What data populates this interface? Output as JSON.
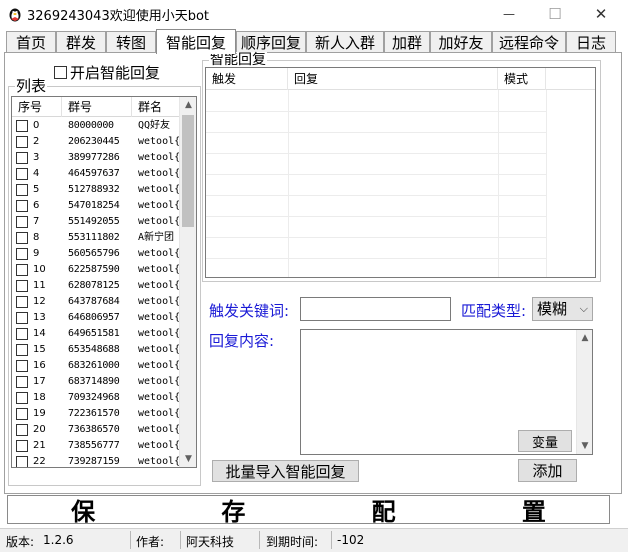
{
  "window": {
    "title": "3269243043欢迎使用小天bot",
    "min_glyph": "—",
    "max_glyph": "☐",
    "close_glyph": "✕"
  },
  "tabs": [
    {
      "label": "首页",
      "active": false
    },
    {
      "label": "群发",
      "active": false
    },
    {
      "label": "转图",
      "active": false
    },
    {
      "label": "智能回复",
      "active": true
    },
    {
      "label": "顺序回复",
      "active": false
    },
    {
      "label": "新人入群",
      "active": false
    },
    {
      "label": "加群",
      "active": false
    },
    {
      "label": "加好友",
      "active": false
    },
    {
      "label": "远程命令",
      "active": false
    },
    {
      "label": "日志",
      "active": false
    }
  ],
  "enable_checkbox": {
    "label": "开启智能回复",
    "checked": false
  },
  "list_panel": {
    "legend": "列表",
    "columns": [
      "序号",
      "群号",
      "群名"
    ],
    "rows": [
      {
        "no": "0",
        "id": "80000000",
        "name": "QQ好友"
      },
      {
        "no": "2",
        "id": "206230445",
        "name": "wetool{"
      },
      {
        "no": "3",
        "id": "389977286",
        "name": "wetool{"
      },
      {
        "no": "4",
        "id": "464597637",
        "name": "wetool{"
      },
      {
        "no": "5",
        "id": "512788932",
        "name": "wetool{"
      },
      {
        "no": "6",
        "id": "547018254",
        "name": "wetool{"
      },
      {
        "no": "7",
        "id": "551492055",
        "name": "wetool{"
      },
      {
        "no": "8",
        "id": "553111802",
        "name": "A新宁团"
      },
      {
        "no": "9",
        "id": "560565796",
        "name": "wetool{"
      },
      {
        "no": "10",
        "id": "622587590",
        "name": "wetool{"
      },
      {
        "no": "11",
        "id": "628078125",
        "name": "wetool{"
      },
      {
        "no": "12",
        "id": "643787684",
        "name": "wetool{"
      },
      {
        "no": "13",
        "id": "646806957",
        "name": "wetool{"
      },
      {
        "no": "14",
        "id": "649651581",
        "name": "wetool{"
      },
      {
        "no": "15",
        "id": "653548688",
        "name": "wetool{"
      },
      {
        "no": "16",
        "id": "683261000",
        "name": "wetool{"
      },
      {
        "no": "17",
        "id": "683714890",
        "name": "wetool{"
      },
      {
        "no": "18",
        "id": "709324968",
        "name": "wetool{"
      },
      {
        "no": "19",
        "id": "722361570",
        "name": "wetool{"
      },
      {
        "no": "20",
        "id": "736386570",
        "name": "wetool{"
      },
      {
        "no": "21",
        "id": "738556777",
        "name": "wetool{"
      },
      {
        "no": "22",
        "id": "739287159",
        "name": "wetool{"
      }
    ]
  },
  "reply_panel": {
    "legend": "智能回复",
    "columns": [
      "触发",
      "回复",
      "模式"
    ]
  },
  "form": {
    "keyword_label": "触发关键词:",
    "keyword_value": "",
    "match_label": "匹配类型:",
    "match_value": "模糊",
    "content_label": "回复内容:",
    "content_value": "",
    "change_button": "变量",
    "import_button": "批量导入智能回复",
    "add_button": "添加"
  },
  "save_bar": {
    "chars": [
      "保",
      "存",
      "配",
      "置"
    ]
  },
  "status": {
    "version_label": "版本:",
    "version_value": "1.2.6",
    "author_label": "作者:",
    "author_value": "阿天科技",
    "expire_label": "到期时间:",
    "expire_value": "-102"
  }
}
